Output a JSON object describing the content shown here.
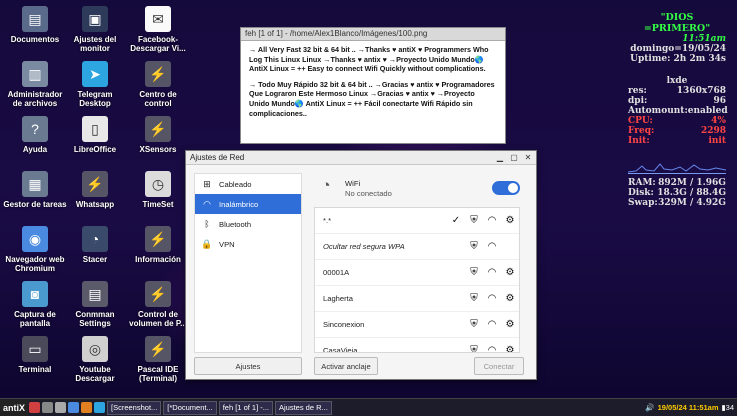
{
  "desktop_icons": [
    {
      "label": "Documentos",
      "icon": "folder-icon",
      "color": "#5a6a8a",
      "glyph": "▤"
    },
    {
      "label": "Ajustes del monitor",
      "icon": "monitor-settings-icon",
      "color": "#2e3a5a",
      "glyph": "▣"
    },
    {
      "label": "Facebook-Descargar Vi...",
      "icon": "facebook-download-icon",
      "color": "#fafafa",
      "glyph": "✉"
    },
    {
      "label": "Administrador de archivos",
      "icon": "file-manager-icon",
      "color": "#7a8aa0",
      "glyph": "▥"
    },
    {
      "label": "Telegram Desktop",
      "icon": "telegram-icon",
      "color": "#2ca5e0",
      "glyph": "➤"
    },
    {
      "label": "Centro de control",
      "icon": "control-center-icon",
      "color": "#555566",
      "glyph": "⚡"
    },
    {
      "label": "Ayuda",
      "icon": "help-icon",
      "color": "#6a7a90",
      "glyph": "?"
    },
    {
      "label": "LibreOffice",
      "icon": "libreoffice-icon",
      "color": "#e8e8e8",
      "glyph": "▯"
    },
    {
      "label": "XSensors",
      "icon": "xsensors-icon",
      "color": "#555566",
      "glyph": "⚡"
    },
    {
      "label": "Gestor de tareas",
      "icon": "task-manager-icon",
      "color": "#6a7a90",
      "glyph": "▦"
    },
    {
      "label": "Whatsapp",
      "icon": "whatsapp-icon",
      "color": "#555566",
      "glyph": "⚡"
    },
    {
      "label": "TimeSet",
      "icon": "clock-icon",
      "color": "#dcdcdc",
      "glyph": "◷"
    },
    {
      "label": "Navegador web Chromium",
      "icon": "chromium-icon",
      "color": "#4a8ae0",
      "glyph": "◉"
    },
    {
      "label": "Stacer",
      "icon": "stacer-icon",
      "color": "#3a4a6a",
      "glyph": "◔"
    },
    {
      "label": "Información",
      "icon": "information-icon",
      "color": "#555566",
      "glyph": "⚡"
    },
    {
      "label": "Captura de pantalla",
      "icon": "screenshot-icon",
      "color": "#4a9ad0",
      "glyph": "◙"
    },
    {
      "label": "Conmman Settings",
      "icon": "connman-settings-icon",
      "color": "#5a5a6a",
      "glyph": "▤"
    },
    {
      "label": "Control de volumen de P...",
      "icon": "volume-control-icon",
      "color": "#555566",
      "glyph": "⚡"
    },
    {
      "label": "Terminal",
      "icon": "terminal-icon",
      "color": "#4a4a5a",
      "glyph": "▭"
    },
    {
      "label": "Youtube Descargar",
      "icon": "youtube-download-icon",
      "color": "#d0d0d0",
      "glyph": "◎"
    },
    {
      "label": "Pascal IDE (Terminal)",
      "icon": "pascal-ide-icon",
      "color": "#555566",
      "glyph": "⚡"
    }
  ],
  "conky": {
    "header": "\"DIOS =PRIMERO\"",
    "time": "11:51am",
    "date": "domingo=19/05/24",
    "uptime": "Uptime: 2h 2m 34s",
    "wm": "lxde",
    "rows": [
      {
        "k": "res:",
        "v": "1360x768"
      },
      {
        "k": "dpi:",
        "v": "96"
      },
      {
        "k": "Automount:",
        "v": "enabled"
      },
      {
        "k": "CPU:",
        "v": "4%"
      },
      {
        "k": "Freq:",
        "v": "2298"
      },
      {
        "k": "Init:",
        "v": "init"
      }
    ],
    "mem_rows": [
      {
        "k": "RAM:",
        "v": "892M / 1.96G"
      },
      {
        "k": "Disk:",
        "v": "18.3G / 88.4G"
      },
      {
        "k": "Swap:",
        "v": "329M / 4.92G"
      }
    ]
  },
  "image_viewer": {
    "title": "feh [1 of 1] - /home/Alex1Blanco/Imágenes/100.png",
    "para1": "→ All Very Fast 32 bit & 64 bit .. →Thanks ♥ antiX ♥ Programmers Who Log This Linux Linux →Thanks ♥ antix ♥ →Proyecto Unido Mundo🌎 AntiX Linux = ++ Easy to connect Wifi Quickly without complications.",
    "para2": "→ Todo Muy Rápido 32 bit & 64 bit .. →Gracias ♥ antix ♥ Programadores Que Lograron Este Hermoso Linux →Gracias ♥ antix ♥ →Proyecto Unido Mundo🌎 AntiX Linux = ++ Fácil conectarte Wifi Rápido sin complicaciones.."
  },
  "network_window": {
    "title": "Ajustes de Red",
    "sidebar": [
      {
        "label": "Cableado",
        "icon": "ethernet-icon",
        "glyph": "⊞",
        "selected": false
      },
      {
        "label": "Inalámbrico",
        "icon": "wifi-icon",
        "glyph": "◠",
        "selected": true
      },
      {
        "label": "Bluetooth",
        "icon": "bluetooth-icon",
        "glyph": "ᛒ",
        "selected": false
      },
      {
        "label": "VPN",
        "icon": "vpn-lock-icon",
        "glyph": "🔒",
        "selected": false
      }
    ],
    "wifi_label": "WiFi",
    "wifi_status": "No conectado",
    "networks": [
      {
        "name": "*.*",
        "italic": false,
        "connected": true
      },
      {
        "name": "Ocultar red segura WPA",
        "italic": true,
        "connected": false,
        "no_gear": true
      },
      {
        "name": "00001A",
        "italic": false,
        "connected": false
      },
      {
        "name": "Lagherta",
        "italic": false,
        "connected": false
      },
      {
        "name": "Sinconexion",
        "italic": false,
        "connected": false
      },
      {
        "name": "CasaVieja",
        "italic": false,
        "connected": false
      }
    ],
    "btn_settings": "Ajustes",
    "btn_tether": "Activar anclaje",
    "btn_connect": "Conectar"
  },
  "taskbar": {
    "start": "antiX",
    "tasks": [
      "[Screenshot...",
      "[*Document...",
      "feh [1 of 1] -...",
      "Ajustes de R..."
    ],
    "clock": "19/05/24 11:51am",
    "battery": "34"
  }
}
